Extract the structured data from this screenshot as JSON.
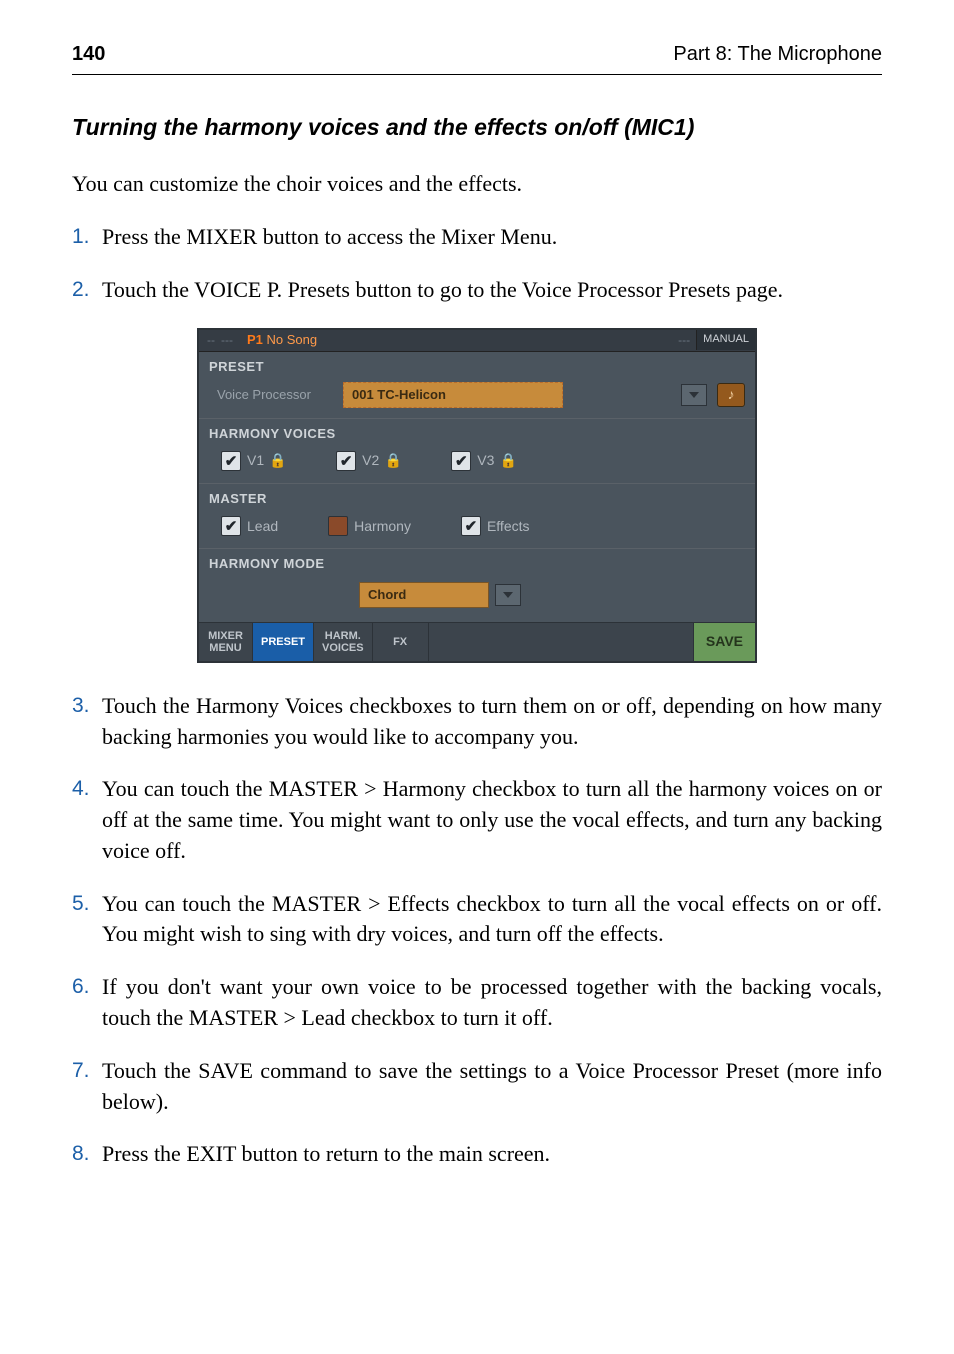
{
  "header": {
    "page_number": "140",
    "part": "Part 8: The Microphone"
  },
  "subheading": "Turning the harmony voices and the effects on/off (MIC1)",
  "intro": "You can customize the choir voices and the effects.",
  "steps": {
    "s1": "Press the MIXER button to access the Mixer Menu.",
    "s2": "Touch the VOICE P. Presets button to go to the Voice Processor Presets page.",
    "s3": "Touch the Harmony Voices checkboxes to turn them on or off, depending on how many backing harmonies you would like to accompany you.",
    "s4": "You can touch the MASTER > Harmony checkbox to turn all the harmony voices on or off at the same time. You might want to only use the vocal effects, and turn any backing voice off.",
    "s5": "You can touch the MASTER > Effects checkbox to turn all the vocal effects on or off. You might wish to sing with dry voices, and turn off the effects.",
    "s6": "If you don't want your own voice to be processed together with the backing vocals, touch the MASTER > Lead checkbox to turn it off.",
    "s7": "Touch the SAVE command to save the settings to a Voice Processor Preset (more info below).",
    "s8": "Press the EXIT button to return to the main screen."
  },
  "nums": {
    "n1": "1.",
    "n2": "2.",
    "n3": "3.",
    "n4": "4.",
    "n5": "5.",
    "n6": "6.",
    "n7": "7.",
    "n8": "8."
  },
  "ui": {
    "topbar": {
      "dashes1": "--",
      "dashes2": "---",
      "p1": "P1",
      "song": "No Song",
      "dashes3": "---",
      "manual": "MANUAL"
    },
    "preset": {
      "title": "PRESET",
      "label": "Voice Processor",
      "value": "001 TC-Helicon",
      "note_glyph": "♪"
    },
    "harmony_voices": {
      "title": "HARMONY VOICES",
      "v1": {
        "label": "V1",
        "checked": true,
        "lock": "orange"
      },
      "v2": {
        "label": "V2",
        "checked": true,
        "lock": "green"
      },
      "v3": {
        "label": "V3",
        "checked": true,
        "lock": "green"
      }
    },
    "master": {
      "title": "MASTER",
      "lead": {
        "label": "Lead",
        "checked": true
      },
      "harmony": {
        "label": "Harmony",
        "checked": false
      },
      "effects": {
        "label": "Effects",
        "checked": true
      }
    },
    "harmony_mode": {
      "title": "HARMONY MODE",
      "value": "Chord"
    },
    "tabs": {
      "mixer_menu_l1": "MIXER",
      "mixer_menu_l2": "MENU",
      "preset": "PRESET",
      "harm_voices_l1": "HARM.",
      "harm_voices_l2": "VOICES",
      "fx": "FX",
      "save": "SAVE"
    },
    "check_glyph": "✔"
  }
}
